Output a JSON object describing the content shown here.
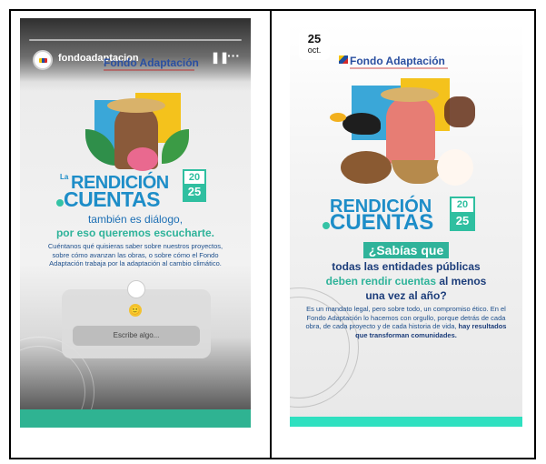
{
  "story1": {
    "account": "fondoadaptacion",
    "time_hint": "5 ...",
    "pause_icon": "pause-icon",
    "more_icon": "more-icon",
    "logo_text": "Fondo Adaptación",
    "la": "La",
    "rendicion": "RENDICIÓN",
    "cuentas": "CUENTAS",
    "year_top": "20",
    "year_bottom": "25",
    "tambien": "también es diálogo,",
    "escucharte": "por eso queremos escucharte.",
    "body": "Cuéntanos qué quisieras saber sobre nuestros proyectos, sobre cómo avanzan las obras, o sobre cómo el Fondo Adaptación trabaja por la adaptación al cambio climático.",
    "question_placeholder": "Escribe algo...",
    "emoji": "🙂"
  },
  "story2": {
    "date_day": "25",
    "date_month": "oct.",
    "logo_text": "Fondo Adaptación",
    "rendicion": "RENDICIÓN",
    "cuentas": "CUENTAS",
    "year_top": "20",
    "year_bottom": "25",
    "sabias": "¿Sabías que",
    "line1": "todas las entidades públicas",
    "line2_green": "deben rendir cuentas",
    "line2_blue": " al menos",
    "line3": "una vez al año?",
    "body_plain": "Es un mandato legal, pero sobre todo, un compromiso ético. En el Fondo Adaptación lo hacemos con orgullo, porque detrás de cada obra, de cada proyecto y de cada historia de vida, ",
    "body_bold": "hay resultados que transforman comunidades."
  },
  "colors": {
    "accent_blue": "#1d8dc8",
    "accent_green": "#2fb39a",
    "navy": "#1c3d7a"
  }
}
